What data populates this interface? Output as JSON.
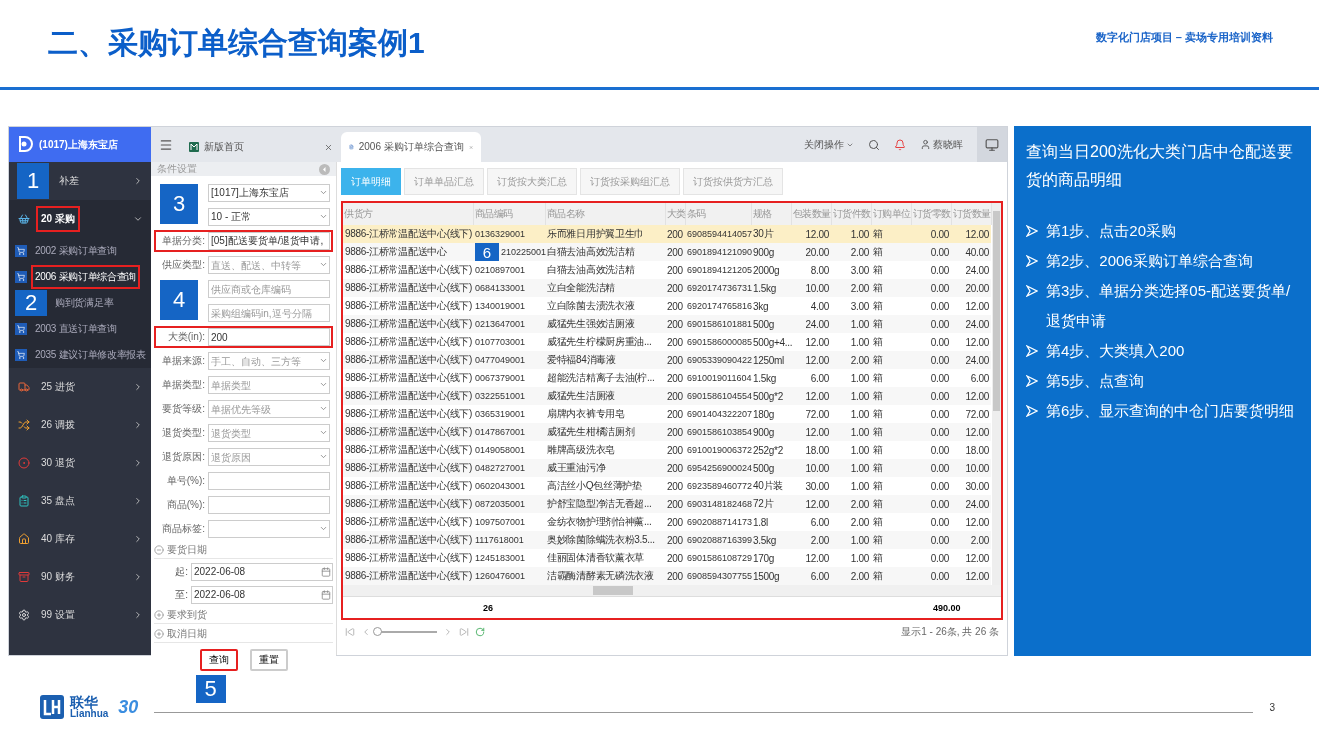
{
  "slide": {
    "title": "二、采购订单综合查询案例1",
    "subtitle": "数字化门店项目 – 卖场专用培训资料",
    "page": "3",
    "logo": {
      "name": "联华",
      "latin": "Lianhua",
      "badge": "30"
    }
  },
  "sidebar": {
    "store": "(1017)上海东宝店",
    "items": [
      {
        "label": "补差",
        "expanded": false,
        "marker": "1"
      },
      {
        "label": "20 采购",
        "expanded": true,
        "highlighted": true,
        "children": [
          {
            "label": "2002 采购订单查询",
            "selected": false
          },
          {
            "label": "2006 采购订单综合查询",
            "selected": true,
            "highlighted": true
          },
          {
            "label": "购到货满足率",
            "selected": false,
            "marker": "2"
          },
          {
            "label": "2003 直送订单查询",
            "selected": false
          },
          {
            "label": "2035 建议订单修改率报表",
            "selected": false
          }
        ]
      },
      {
        "label": "25 进货",
        "expanded": false
      },
      {
        "label": "26 调拨",
        "expanded": false
      },
      {
        "label": "30 退货",
        "expanded": false
      },
      {
        "label": "35 盘点",
        "expanded": false
      },
      {
        "label": "40 库存",
        "expanded": false
      },
      {
        "label": "90 财务",
        "expanded": false
      },
      {
        "label": "99 设置",
        "expanded": false
      }
    ]
  },
  "topbar": {
    "tabs": [
      {
        "label": "新版首页",
        "selected": false
      },
      {
        "label": "2006 采购订单综合查询",
        "selected": true
      }
    ],
    "close_menu": "关闭操作",
    "user": "蔡晓晖"
  },
  "conditions": {
    "title": "条件设置",
    "fields": [
      {
        "kind": "select",
        "value": "[1017]上海东宝店",
        "marker": "3"
      },
      {
        "kind": "select",
        "value": "10 - 正常"
      },
      {
        "kind": "input",
        "label": "单据分类:",
        "value": "[05]配送要货单/退货申请,",
        "highlighted": true
      },
      {
        "kind": "select",
        "label": "供应类型:",
        "placeholder": "直送、配送、中转等"
      },
      {
        "kind": "input",
        "placeholder": "供应商或仓库编码",
        "marker": "4"
      },
      {
        "kind": "input",
        "placeholder": "采购组编码in,逗号分隔"
      },
      {
        "kind": "input",
        "label": "大类(in):",
        "value": "200",
        "highlighted": true
      },
      {
        "kind": "select",
        "label": "单据来源:",
        "placeholder": "手工、自动、三方等"
      },
      {
        "kind": "select",
        "label": "单据类型:",
        "placeholder": "单据类型"
      },
      {
        "kind": "select",
        "label": "要货等级:",
        "placeholder": "单据优先等级"
      },
      {
        "kind": "select",
        "label": "退货类型:",
        "placeholder": "退货类型"
      },
      {
        "kind": "select",
        "label": "退货原因:",
        "placeholder": "退货原因"
      },
      {
        "kind": "input",
        "label": "单号(%):"
      },
      {
        "kind": "input",
        "label": "商品(%):"
      },
      {
        "kind": "select",
        "label": "商品标签:"
      }
    ],
    "date_sections": [
      {
        "label": "要货日期",
        "expanded": true,
        "from_label": "起:",
        "from": "2022-06-08",
        "to_label": "至:",
        "to": "2022-06-08"
      },
      {
        "label": "要求到货",
        "expanded": false
      },
      {
        "label": "取消日期",
        "expanded": false
      }
    ],
    "buttons": [
      {
        "label": "查询",
        "highlighted": true,
        "marker": "5"
      },
      {
        "label": "重置",
        "highlighted": false
      }
    ]
  },
  "results": {
    "tabs": [
      {
        "label": "订单明细",
        "selected": true
      },
      {
        "label": "订单单品汇总",
        "selected": false
      },
      {
        "label": "订货按大类汇总",
        "selected": false
      },
      {
        "label": "订货按采购组汇总",
        "selected": false
      },
      {
        "label": "订货按供货方汇总",
        "selected": false
      }
    ],
    "highlighted": true,
    "columns": [
      "供货方",
      "商品编码",
      "商品名称",
      "大类",
      "条码",
      "规格",
      "包装数量",
      "订货件数",
      "订购单位",
      "订货零数",
      "订货数量"
    ],
    "rows": [
      {
        "selected": true,
        "cells": [
          "9886-江桥常温配送中心(线下)",
          "0136329001",
          "乐而雅日用护翼卫生巾",
          "200",
          "6908594414057",
          "30片",
          "12.00",
          "1.00",
          "箱",
          "0.00",
          "12.00"
        ]
      },
      {
        "selected": false,
        "marker": "6",
        "cells": [
          "9886-江桥常温配送中心",
          "210225001",
          "白猫去油高效洗洁精",
          "200",
          "6901894121090",
          "900g",
          "20.00",
          "2.00",
          "箱",
          "0.00",
          "40.00"
        ]
      },
      {
        "selected": false,
        "cells": [
          "9886-江桥常温配送中心(线下)",
          "0210897001",
          "白猫去油高效洗洁精",
          "200",
          "6901894121205",
          "2000g",
          "8.00",
          "3.00",
          "箱",
          "0.00",
          "24.00"
        ]
      },
      {
        "selected": false,
        "cells": [
          "9886-江桥常温配送中心(线下)",
          "0684133001",
          "立白全能洗洁精",
          "200",
          "6920174736731",
          "1.5kg",
          "10.00",
          "2.00",
          "箱",
          "0.00",
          "20.00"
        ]
      },
      {
        "selected": false,
        "cells": [
          "9886-江桥常温配送中心(线下)",
          "1340019001",
          "立白除菌去渍洗衣液",
          "200",
          "6920174765816",
          "3kg",
          "4.00",
          "3.00",
          "箱",
          "0.00",
          "12.00"
        ]
      },
      {
        "selected": false,
        "cells": [
          "9886-江桥常温配送中心(线下)",
          "0213647001",
          "威猛先生强效洁厕液",
          "200",
          "6901586101881",
          "500g",
          "24.00",
          "1.00",
          "箱",
          "0.00",
          "24.00"
        ]
      },
      {
        "selected": false,
        "cells": [
          "9886-江桥常温配送中心(线下)",
          "0107703001",
          "威猛先生柠檬厨房重油...",
          "200",
          "6901586000085",
          "500g+4...",
          "12.00",
          "1.00",
          "箱",
          "0.00",
          "12.00"
        ]
      },
      {
        "selected": false,
        "cells": [
          "9886-江桥常温配送中心(线下)",
          "0477049001",
          "爱特福84消毒液",
          "200",
          "6905339090422",
          "1250ml",
          "12.00",
          "2.00",
          "箱",
          "0.00",
          "24.00"
        ]
      },
      {
        "selected": false,
        "cells": [
          "9886-江桥常温配送中心(线下)",
          "0067379001",
          "超能洗洁精离子去油(柠...",
          "200",
          "6910019011604",
          "1.5kg",
          "6.00",
          "1.00",
          "箱",
          "0.00",
          "6.00"
        ]
      },
      {
        "selected": false,
        "cells": [
          "9886-江桥常温配送中心(线下)",
          "0322551001",
          "威猛先生洁厕液",
          "200",
          "6901586104554",
          "500g*2",
          "12.00",
          "1.00",
          "箱",
          "0.00",
          "12.00"
        ]
      },
      {
        "selected": false,
        "cells": [
          "9886-江桥常温配送中心(线下)",
          "0365319001",
          "扇牌内衣裤专用皂",
          "200",
          "6901404322207",
          "180g",
          "72.00",
          "1.00",
          "箱",
          "0.00",
          "72.00"
        ]
      },
      {
        "selected": false,
        "cells": [
          "9886-江桥常温配送中心(线下)",
          "0147867001",
          "威猛先生柑橘洁厕剂",
          "200",
          "6901586103854",
          "900g",
          "12.00",
          "1.00",
          "箱",
          "0.00",
          "12.00"
        ]
      },
      {
        "selected": false,
        "cells": [
          "9886-江桥常温配送中心(线下)",
          "0149058001",
          "雕牌高级洗衣皂",
          "200",
          "6910019006372",
          "252g*2",
          "18.00",
          "1.00",
          "箱",
          "0.00",
          "18.00"
        ]
      },
      {
        "selected": false,
        "cells": [
          "9886-江桥常温配送中心(线下)",
          "0482727001",
          "威王重油污净",
          "200",
          "6954256900024",
          "500g",
          "10.00",
          "1.00",
          "箱",
          "0.00",
          "10.00"
        ]
      },
      {
        "selected": false,
        "cells": [
          "9886-江桥常温配送中心(线下)",
          "0602043001",
          "高洁丝小Q包丝薄护垫",
          "200",
          "6923589460772",
          "40片装",
          "30.00",
          "1.00",
          "箱",
          "0.00",
          "30.00"
        ]
      },
      {
        "selected": false,
        "cells": [
          "9886-江桥常温配送中心(线下)",
          "0872035001",
          "护舒宝隐型净洁无香超...",
          "200",
          "6903148182468",
          "72片",
          "12.00",
          "2.00",
          "箱",
          "0.00",
          "24.00"
        ]
      },
      {
        "selected": false,
        "cells": [
          "9886-江桥常温配送中心(线下)",
          "1097507001",
          "金纺衣物护理剂怡神薰...",
          "200",
          "6902088714173",
          "1.8l",
          "6.00",
          "2.00",
          "箱",
          "0.00",
          "12.00"
        ]
      },
      {
        "selected": false,
        "cells": [
          "9886-江桥常温配送中心(线下)",
          "1117618001",
          "奥妙除菌除螨洗衣粉3.5...",
          "200",
          "6902088716399",
          "3.5kg",
          "2.00",
          "1.00",
          "箱",
          "0.00",
          "2.00"
        ]
      },
      {
        "selected": false,
        "cells": [
          "9886-江桥常温配送中心(线下)",
          "1245183001",
          "佳丽固体清香软薰衣草",
          "200",
          "6901586108729",
          "170g",
          "12.00",
          "1.00",
          "箱",
          "0.00",
          "12.00"
        ]
      },
      {
        "selected": false,
        "cells": [
          "9886-江桥常温配送中心(线下)",
          "1260476001",
          "洁霸酶清酵素无磷洗衣液",
          "200",
          "6908594307755",
          "1500g",
          "6.00",
          "2.00",
          "箱",
          "0.00",
          "12.00"
        ]
      }
    ],
    "footer": {
      "count": "26",
      "total": "490.00"
    },
    "pager": {
      "text": "显示1 - 26条, 共 26 条",
      "level": 0
    }
  },
  "panel": {
    "title": "查询当日200洗化大类门店中仓配送要货的商品明细",
    "steps": [
      "第1步、点击20采购",
      "第2步、2006采购订单综合查询",
      "第3步、单据分类选择05-配送要货单/退货申请",
      "第4步、大类填入200",
      "第5步、点查询",
      "第6步、显示查询的中仓门店要货明细"
    ]
  }
}
